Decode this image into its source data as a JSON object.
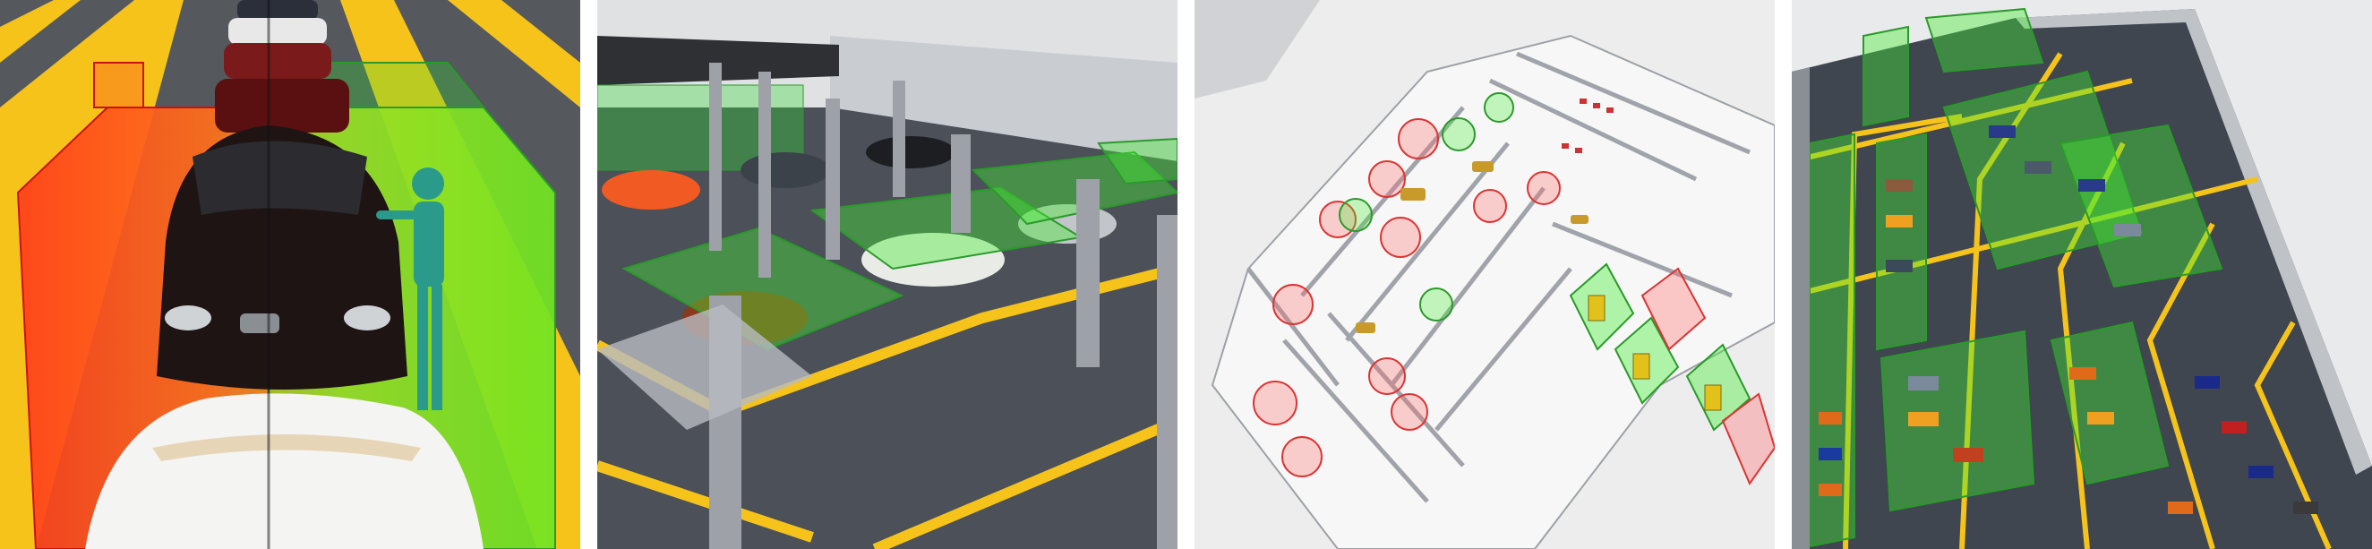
{
  "panels": [
    {
      "id": "assembly-line-closeup"
    },
    {
      "id": "factory-floor-perspective"
    },
    {
      "id": "office-floorplan-aerial"
    },
    {
      "id": "parking-garage-aerial"
    }
  ],
  "colors": {
    "zone_green": "#33dd33",
    "zone_red": "#ee2222",
    "zone_orange": "#ff8800",
    "floor_yellow": "#f6c31a",
    "floor_grey": "#4b5059",
    "wall_grey": "#a9adb3",
    "car_white": "#f4f4f2"
  }
}
